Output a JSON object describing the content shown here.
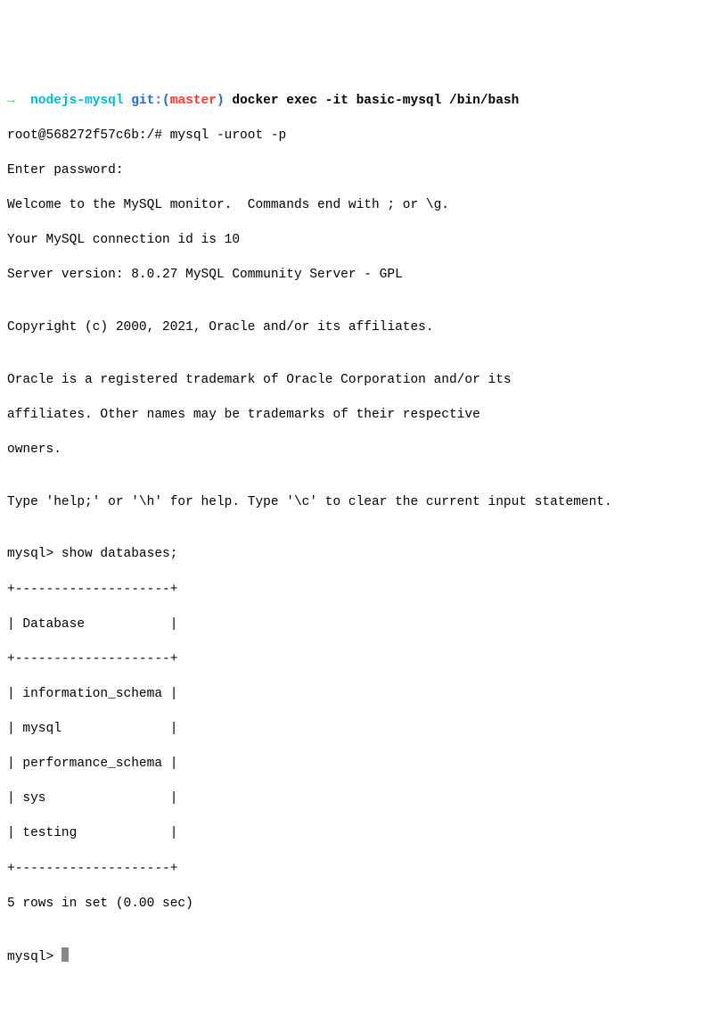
{
  "prompt": {
    "arrow": "→",
    "dir": "nodejs-mysql",
    "git_label": "git:",
    "branch_open": "(",
    "branch": "master",
    "branch_close": ")",
    "cmd": "docker exec -it basic-mysql /bin/bash"
  },
  "lines": {
    "bash_prompt": "root@568272f57c6b:/# mysql -uroot -p",
    "enter_pw": "Enter password:",
    "welcome": "Welcome to the MySQL monitor.  Commands end with ; or \\g.",
    "conn_id": "Your MySQL connection id is 10",
    "server": "Server version: 8.0.27 MySQL Community Server - GPL",
    "blank": "",
    "copyright": "Copyright (c) 2000, 2021, Oracle and/or its affiliates.",
    "tm1": "Oracle is a registered trademark of Oracle Corporation and/or its",
    "tm2": "affiliates. Other names may be trademarks of their respective",
    "tm3": "owners.",
    "help": "Type 'help;' or '\\h' for help. Type '\\c' to clear the current input statement.",
    "mysql_show": "mysql> show databases;",
    "sep": "+--------------------+",
    "hdr": "| Database           |",
    "row1": "| information_schema |",
    "row2": "| mysql              |",
    "row3": "| performance_schema |",
    "row4": "| sys                |",
    "row5": "| testing            |",
    "rows_in_set": "5 rows in set (0.00 sec)",
    "mysql_prompt": "mysql> "
  },
  "chart_data": {
    "type": "table",
    "title": "show databases;",
    "columns": [
      "Database"
    ],
    "rows": [
      [
        "information_schema"
      ],
      [
        "mysql"
      ],
      [
        "performance_schema"
      ],
      [
        "sys"
      ],
      [
        "testing"
      ]
    ],
    "footer": "5 rows in set (0.00 sec)"
  }
}
